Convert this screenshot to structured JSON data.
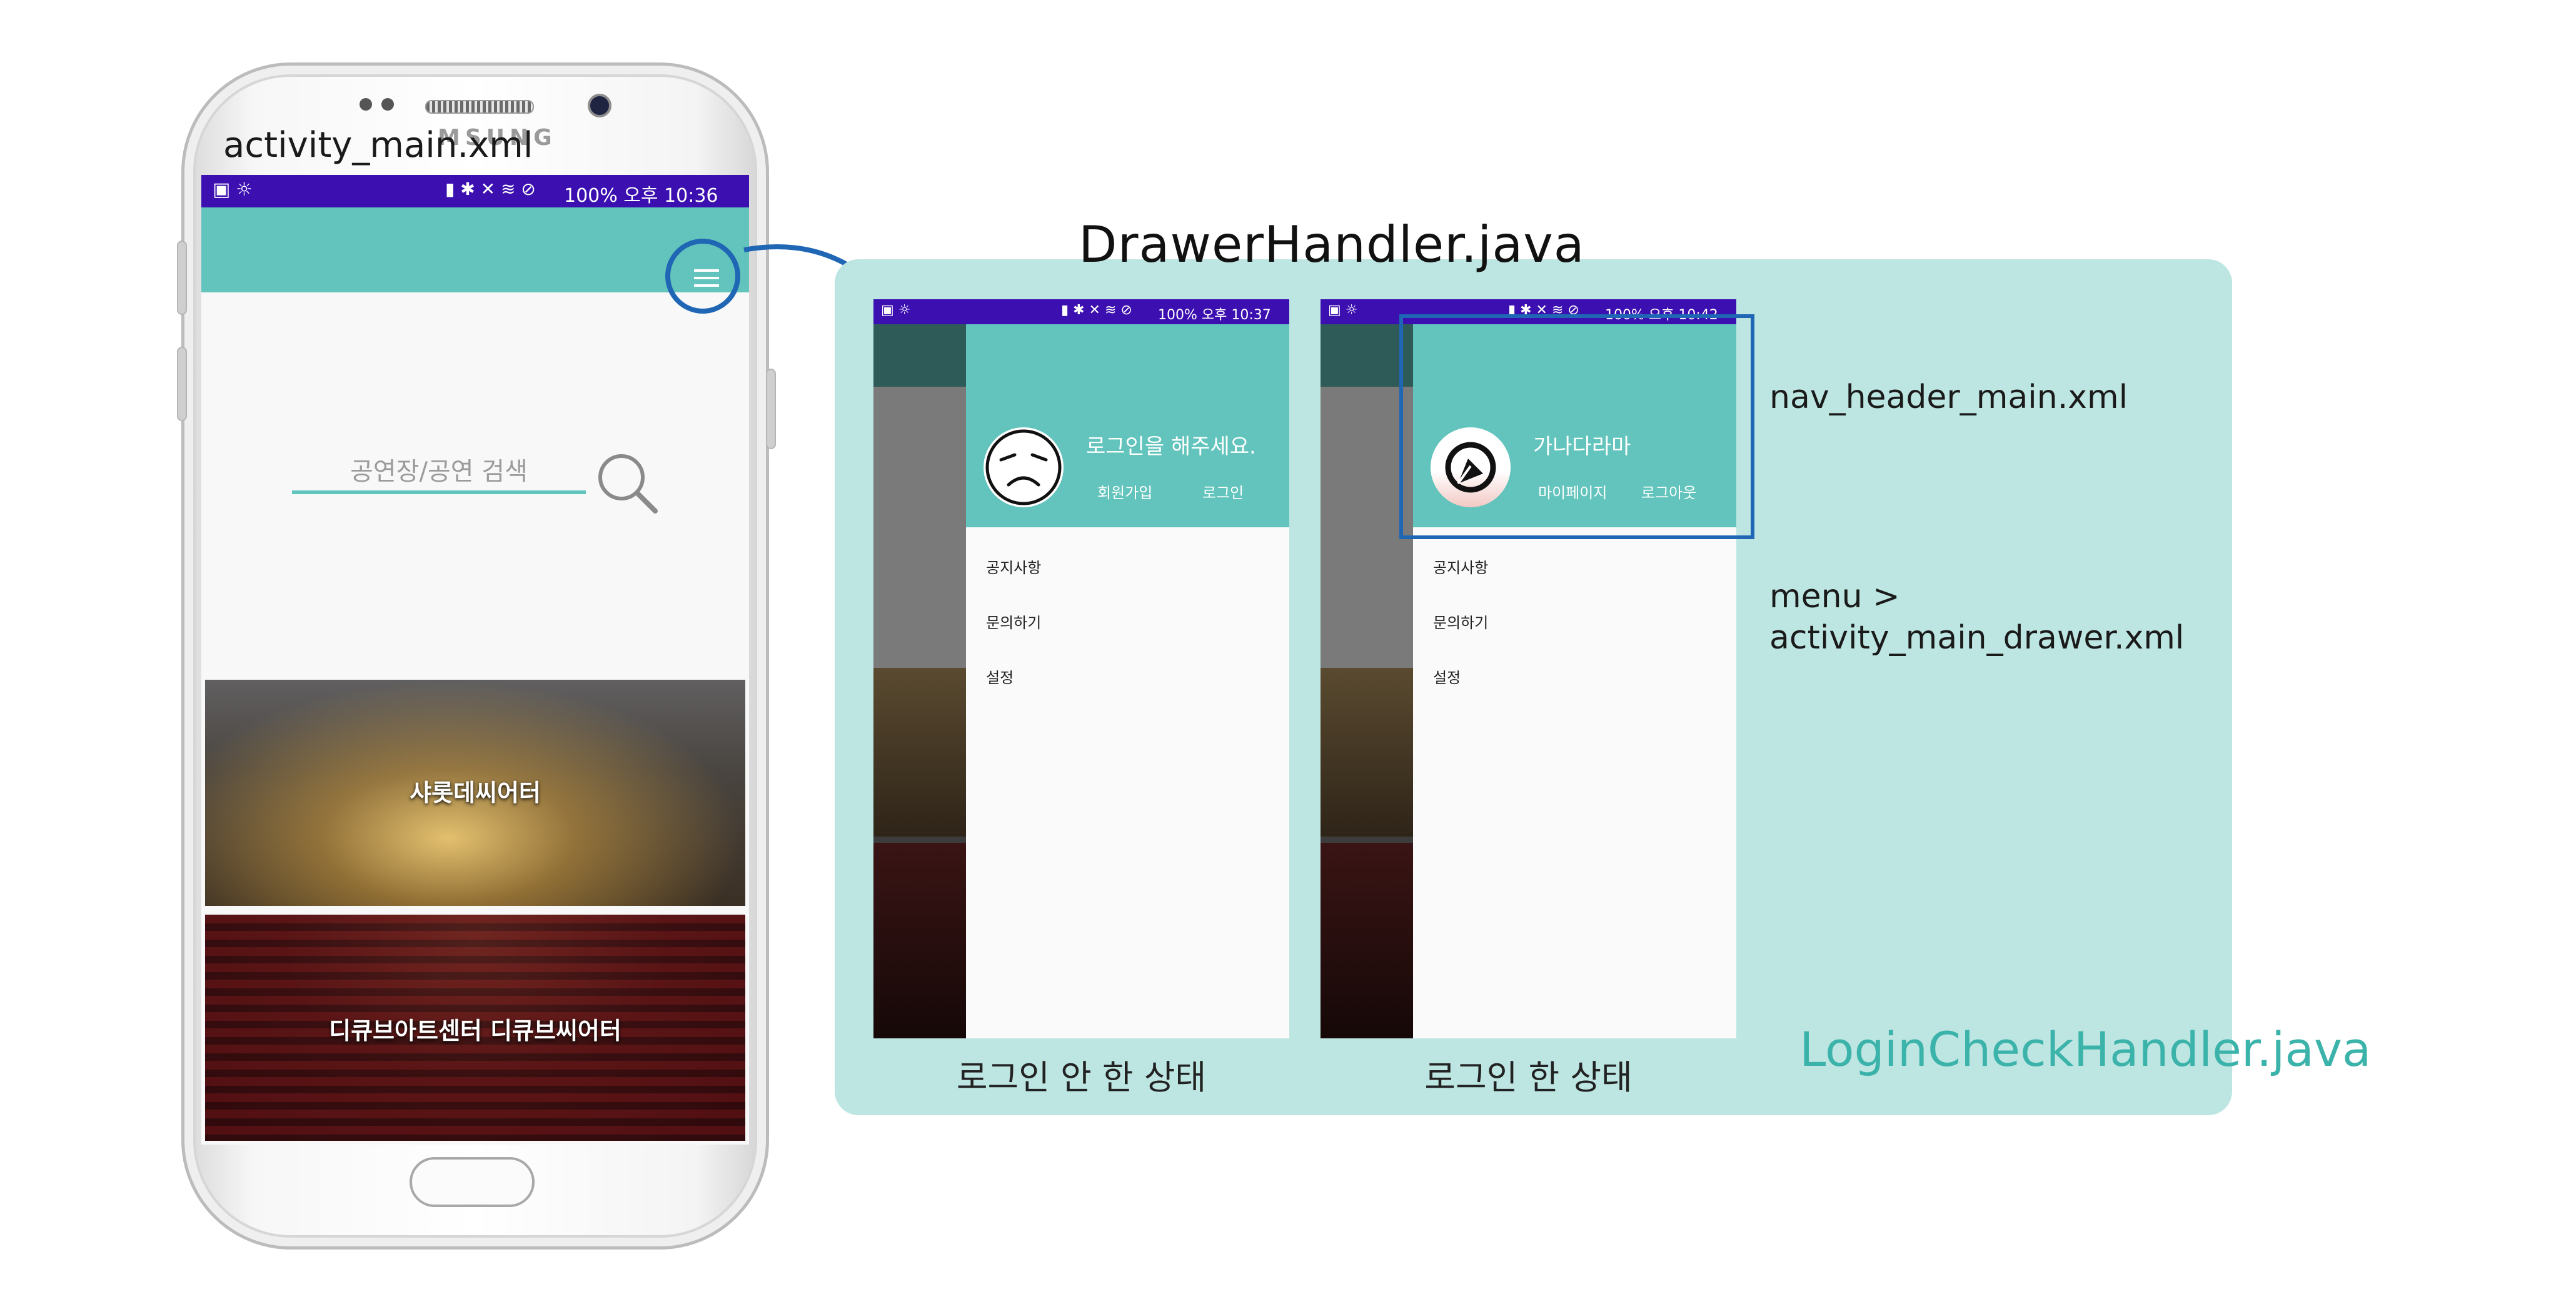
{
  "phone": {
    "file_label": "activity_main.xml",
    "brand": "MSUNG",
    "status_bar": {
      "text": "100% 오후 10:36"
    },
    "search": {
      "placeholder": "공연장/공연 검색"
    },
    "theaters": [
      {
        "name": "샤롯데씨어터"
      },
      {
        "name": "디큐브아트센터 디큐브씨어터"
      }
    ]
  },
  "drawer_title": "DrawerHandler.java",
  "login_handler_title": "LoginCheckHandler.java",
  "labels": {
    "nav_header": "nav_header_main.xml",
    "menu_line1": "menu >",
    "menu_line2": "activity_main_drawer.xml"
  },
  "screens": {
    "logged_out": {
      "status_text": "100% 오후 10:37",
      "header_title": "로그인을 해주세요.",
      "link_left": "회원가입",
      "link_right": "로그인",
      "caption": "로그인 안 한 상태"
    },
    "logged_in": {
      "status_text": "100% 오후 10:42",
      "header_title": "가나다라마",
      "link_left": "마이페이지",
      "link_right": "로그아웃",
      "caption": "로그인 한 상태"
    },
    "menu_items": [
      "공지사항",
      "문의하기",
      "설정"
    ]
  },
  "colors": {
    "teal": "#62c4bc",
    "panel": "#bde6e2",
    "status_bar": "#3b0fb0",
    "highlight": "#1f66b5",
    "login_handler_text": "#3bb3aa"
  }
}
